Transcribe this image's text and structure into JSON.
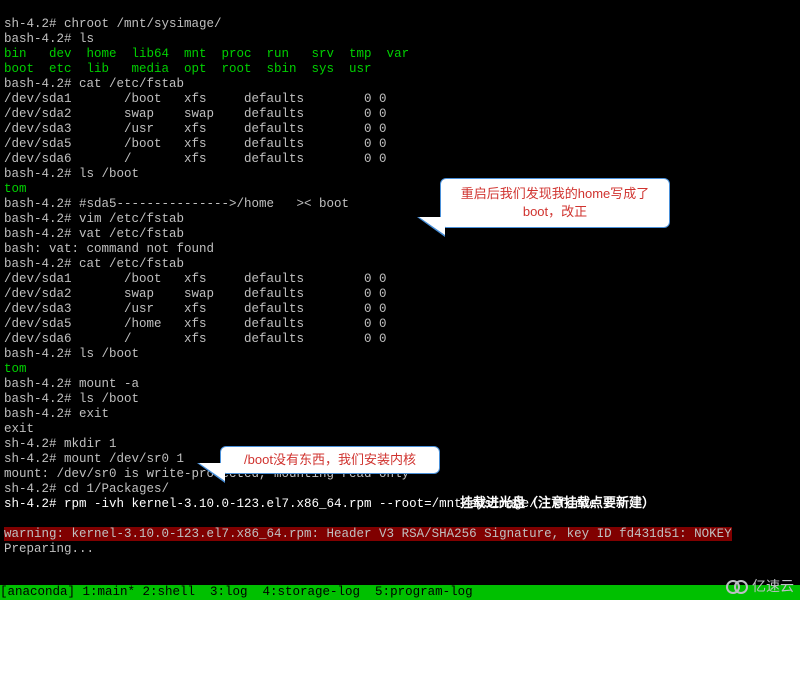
{
  "lines": [
    [
      {
        "cls": "gray",
        "t": "sh-4.2# chroot /mnt/sysimage/"
      }
    ],
    [
      {
        "cls": "gray",
        "t": "bash-4.2# ls"
      }
    ],
    [
      {
        "cls": "green",
        "t": "bin   dev  home  lib64  mnt  proc  run   srv  tmp  var"
      }
    ],
    [
      {
        "cls": "green",
        "t": "boot  etc  lib   media  opt  root  sbin  sys  usr"
      }
    ],
    [
      {
        "cls": "gray",
        "t": "bash-4.2# cat /etc/fstab"
      }
    ],
    [
      {
        "cls": "gray",
        "t": "/dev/sda1       /boot   xfs     defaults        0 0"
      }
    ],
    [
      {
        "cls": "gray",
        "t": "/dev/sda2       swap    swap    defaults        0 0"
      }
    ],
    [
      {
        "cls": "gray",
        "t": "/dev/sda3       /usr    xfs     defaults        0 0"
      }
    ],
    [
      {
        "cls": "gray",
        "t": "/dev/sda5       /boot   xfs     defaults        0 0"
      }
    ],
    [
      {
        "cls": "gray",
        "t": "/dev/sda6       /       xfs     defaults        0 0"
      }
    ],
    [
      {
        "cls": "gray",
        "t": "bash-4.2# ls /boot"
      }
    ],
    [
      {
        "cls": "green",
        "t": "tom"
      }
    ],
    [
      {
        "cls": "gray",
        "t": "bash-4.2# #sda5--------------->/home   >< boot"
      }
    ],
    [
      {
        "cls": "gray",
        "t": "bash-4.2# vim /etc/fstab"
      }
    ],
    [
      {
        "cls": "gray",
        "t": "bash-4.2# vat /etc/fstab"
      }
    ],
    [
      {
        "cls": "gray",
        "t": "bash: vat: command not found"
      }
    ],
    [
      {
        "cls": "gray",
        "t": "bash-4.2# cat /etc/fstab"
      }
    ],
    [
      {
        "cls": "gray",
        "t": "/dev/sda1       /boot   xfs     defaults        0 0"
      }
    ],
    [
      {
        "cls": "gray",
        "t": "/dev/sda2       swap    swap    defaults        0 0"
      }
    ],
    [
      {
        "cls": "gray",
        "t": "/dev/sda3       /usr    xfs     defaults        0 0"
      }
    ],
    [
      {
        "cls": "gray",
        "t": "/dev/sda5       /home   xfs     defaults        0 0"
      }
    ],
    [
      {
        "cls": "gray",
        "t": "/dev/sda6       /       xfs     defaults        0 0"
      }
    ],
    [
      {
        "cls": "gray",
        "t": "bash-4.2# ls /boot"
      }
    ],
    [
      {
        "cls": "green",
        "t": "tom"
      }
    ],
    [
      {
        "cls": "gray",
        "t": "bash-4.2# mount -a"
      }
    ],
    [
      {
        "cls": "gray",
        "t": "bash-4.2# ls /boot"
      }
    ],
    [
      {
        "cls": "gray",
        "t": "bash-4.2# exit"
      }
    ],
    [
      {
        "cls": "gray",
        "t": "exit"
      }
    ],
    [
      {
        "cls": "gray",
        "t": "sh-4.2# mkdir 1"
      }
    ],
    [
      {
        "cls": "gray",
        "t": "sh-4.2# mount /dev/sr0 1"
      }
    ],
    [
      {
        "cls": "gray",
        "t": "mount: /dev/sr0 is write-protected, mounting read-only"
      }
    ],
    [
      {
        "cls": "gray",
        "t": "sh-4.2# cd 1/Packages/"
      }
    ],
    [
      {
        "cls": "white",
        "t": "sh-4.2# rpm -ivh kernel-3.10.0-123.el7.x86_64.rpm --root=/mnt/sysimage/ --force"
      }
    ]
  ],
  "warnline": "warning: kernel-3.10.0-123.el7.x86_64.rpm: Header V3 RSA/SHA256 Signature, key ID fd431d51: NOKEY",
  "preparing": "Preparing...",
  "statusbar": "[anaconda] 1:main* 2:shell  3:log  4:storage-log  5:program-log",
  "callout1_pre": "重启后我们发现我的",
  "callout1_home": "home",
  "callout1_post": "写成了boot，改正",
  "callout2_boot": "/boot",
  "callout2_text": "没有东西，我们安装内核",
  "note3": "挂载进光盘（注意挂载点要新建）",
  "watermark": "亿速云"
}
